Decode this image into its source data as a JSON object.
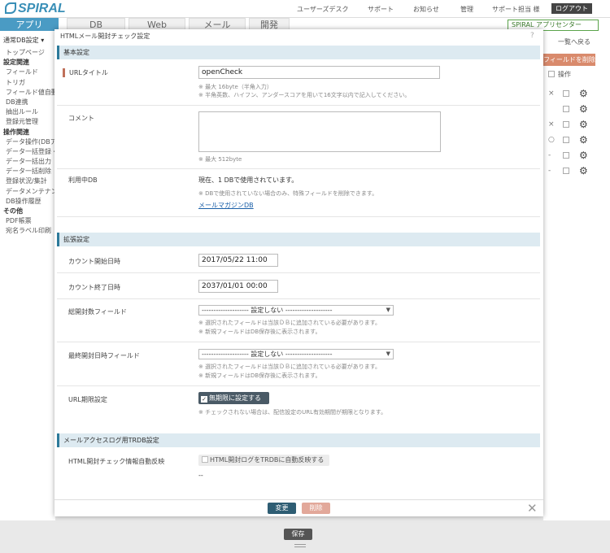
{
  "app": {
    "logo": "SPIRAL",
    "top_links": [
      "ユーザーズデスク",
      "サポート",
      "お知らせ",
      "管理",
      "サポート担当 様"
    ],
    "logout": "ログアウト",
    "nav_tabs": [
      "アプリ",
      "DB",
      "Web",
      "メール",
      "開発"
    ],
    "spiral_app_center": "SPIRAL アプリセンター",
    "sidebar": {
      "select": "通常DB設定",
      "items": [
        {
          "label": "トップページ",
          "head": false
        },
        {
          "label": "設定関連",
          "head": true
        },
        {
          "label": "フィールド",
          "head": false
        },
        {
          "label": "トリガ",
          "head": false
        },
        {
          "label": "フィールド値自動",
          "head": false
        },
        {
          "label": "DB連携",
          "head": false
        },
        {
          "label": "抽出ルール",
          "head": false
        },
        {
          "label": "登録元管理",
          "head": false
        },
        {
          "label": "操作関連",
          "head": true
        },
        {
          "label": "データ操作(DBアクセス)",
          "head": false
        },
        {
          "label": "データ一括登録・更新",
          "head": false
        },
        {
          "label": "データ一括出力",
          "head": false
        },
        {
          "label": "データ一括削除",
          "head": false
        },
        {
          "label": "登録状況/集計",
          "head": false
        },
        {
          "label": "データメンテナンス",
          "head": false
        },
        {
          "label": "DB操作履歴",
          "head": false
        },
        {
          "label": "その他",
          "head": true
        },
        {
          "label": "PDF帳票",
          "head": false
        },
        {
          "label": "宛名ラベル印刷",
          "head": false
        }
      ]
    },
    "right_pane": {
      "list_link": "一覧へ戻る",
      "delete_field_button": "フィールドを削除",
      "col_operation": "操作",
      "row_marks": [
        "×",
        "",
        "×",
        "○",
        "-",
        "-"
      ]
    },
    "save_button": "保存"
  },
  "modal": {
    "title": "HTMLメール開封チェック設定",
    "help": "?",
    "basic": {
      "heading": "基本設定",
      "url_title_label": "URLタイトル",
      "url_title_value": "openCheck",
      "url_title_notes": [
        "※ 最大 16byte（半角入力）",
        "※ 半角英数、ハイフン、アンダースコアを用いて16文字以内で記入してください。"
      ],
      "comment_label": "コメント",
      "comment_value": "",
      "comment_note": "※ 最大 512byte",
      "used_db_label": "利用中DB",
      "used_db_text": "現在、1 DBで使用されています。",
      "used_db_note": "※ DBで使用されていない場合のみ、特殊フィールドを削除できます。",
      "used_db_link": "メールマガジンDB"
    },
    "extended": {
      "heading": "拡張設定",
      "count_start_label": "カウント開始日時",
      "count_start_value": "2017/05/22 11:00",
      "count_end_label": "カウント終了日時",
      "count_end_value": "2037/01/01 00:00",
      "total_field_label": "総開封数フィールド",
      "total_field_value": "-------------------- 設定しない --------------------",
      "total_field_notes": [
        "※ 選択されたフィールドは当該ＤＢに追加されている必要があります。",
        "※ 新規フィールドはDB保存後に表示されます。"
      ],
      "last_field_label": "最終開封日時フィールド",
      "last_field_value": "-------------------- 設定しない --------------------",
      "last_field_notes": [
        "※ 選択されたフィールドは当該ＤＢに追加されている必要があります。",
        "※ 新規フィールドはDB保存後に表示されます。"
      ],
      "url_expiry_label": "URL期限設定",
      "url_expiry_check": "無期限に設定する",
      "url_expiry_checked": true,
      "url_expiry_note": "※ チェックされない場合は、配信設定のURL有効期間が期限となります。"
    },
    "access_log": {
      "heading": "メールアクセスログ用TRDB設定",
      "auto_reflect_label": "HTML開封チェック情報自動反映",
      "auto_reflect_check": "HTML開封ログをTRDBに自動反映する",
      "auto_reflect_checked": false,
      "dash": "--"
    },
    "footer": {
      "change_button": "変更",
      "delete_button": "削除",
      "close": "✕"
    }
  }
}
